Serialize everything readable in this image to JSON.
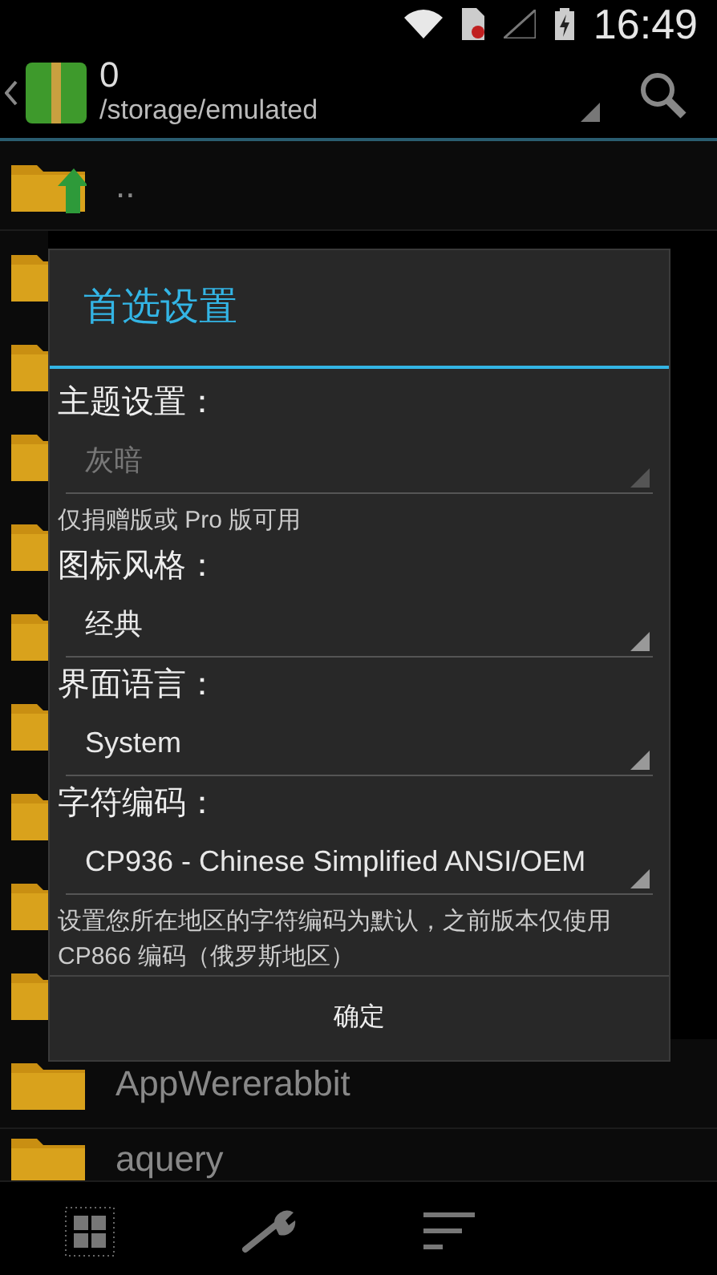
{
  "status_bar": {
    "time": "16:49"
  },
  "action_bar": {
    "title": "0",
    "path": "/storage/emulated"
  },
  "files": [
    {
      "kind": "parent",
      "name": ".."
    },
    {
      "kind": "folder"
    },
    {
      "kind": "folder"
    },
    {
      "kind": "folder"
    },
    {
      "kind": "folder"
    },
    {
      "kind": "folder"
    },
    {
      "kind": "folder"
    },
    {
      "kind": "folder"
    },
    {
      "kind": "folder"
    },
    {
      "kind": "folder"
    },
    {
      "kind": "folder",
      "name": "AppWererabbit"
    },
    {
      "kind": "folder",
      "name": "aquery"
    }
  ],
  "dialog": {
    "title": "首选设置",
    "sections": [
      {
        "label": "主题设置：",
        "value": "灰暗",
        "disabled": true,
        "note": "仅捐赠版或 Pro 版可用"
      },
      {
        "label": "图标风格：",
        "value": "经典",
        "disabled": false
      },
      {
        "label": "界面语言：",
        "value": "System",
        "disabled": false
      },
      {
        "label": "字符编码：",
        "value": "CP936 - Chinese Simplified ANSI/OEM",
        "disabled": false,
        "note": "设置您所在地区的字符编码为默认，之前版本仅使用 CP866 编码（俄罗斯地区）"
      }
    ],
    "button": "确定"
  }
}
